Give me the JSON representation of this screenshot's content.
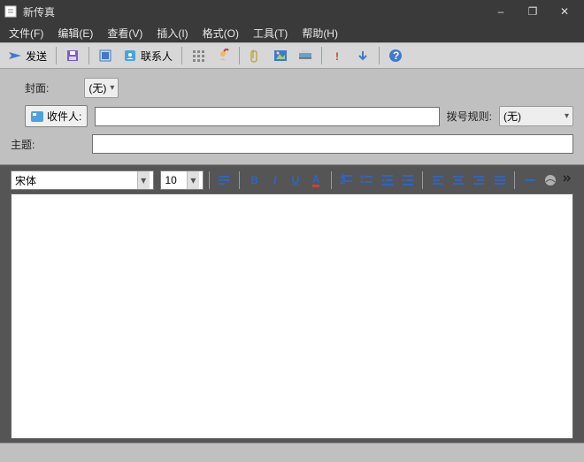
{
  "window": {
    "title": "新传真",
    "minimize": "–",
    "restore": "❐",
    "close": "✕"
  },
  "menu": {
    "file": "文件(F)",
    "edit": "编辑(E)",
    "view": "查看(V)",
    "insert": "插入(I)",
    "format": "格式(O)",
    "tools": "工具(T)",
    "help": "帮助(H)"
  },
  "toolbar": {
    "send": "发送",
    "contacts": "联系人"
  },
  "form": {
    "cover_label": "封面:",
    "cover_value": "(无)",
    "recipients_label": "收件人:",
    "recipients_value": "",
    "dialrule_label": "拨号规则:",
    "dialrule_value": "(无)",
    "subject_label": "主题:",
    "subject_value": ""
  },
  "editor": {
    "font": "宋体",
    "size": "10",
    "bold": "B",
    "italic": "I",
    "underline": "U",
    "font_a": "A"
  }
}
